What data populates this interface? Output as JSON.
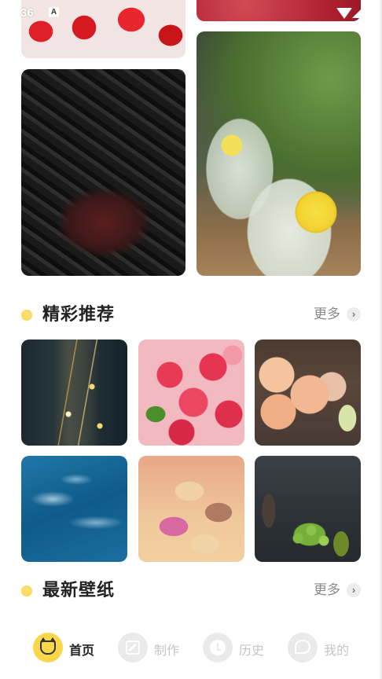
{
  "status_bar": {
    "time": "36",
    "notification_letter": "A"
  },
  "gallery_top": [
    {
      "name": "strawberry"
    },
    {
      "name": "red-texture"
    },
    {
      "name": "dark-cubes"
    },
    {
      "name": "lemon-drinks"
    }
  ],
  "sections": {
    "featured": {
      "title": "精彩推荐",
      "more": "更多",
      "chevron": "›"
    },
    "latest": {
      "title": "最新壁纸",
      "more": "更多",
      "chevron": "›"
    }
  },
  "featured_grid": [
    {
      "name": "night-traffic"
    },
    {
      "name": "raspberries"
    },
    {
      "name": "peaches-melon"
    },
    {
      "name": "ocean-waves"
    },
    {
      "name": "macarons"
    },
    {
      "name": "grapes-pear"
    }
  ],
  "bottom_nav": {
    "items": [
      {
        "label": "首页",
        "icon": "cat-icon",
        "active": true
      },
      {
        "label": "制作",
        "icon": "edit-icon",
        "active": false
      },
      {
        "label": "历史",
        "icon": "clock-icon",
        "active": false
      },
      {
        "label": "我的",
        "icon": "chat-icon",
        "active": false
      }
    ]
  },
  "colors": {
    "accent": "#f8d84a",
    "title": "#222222",
    "muted": "#8a8a8a",
    "inactive": "#c5c5c5"
  }
}
